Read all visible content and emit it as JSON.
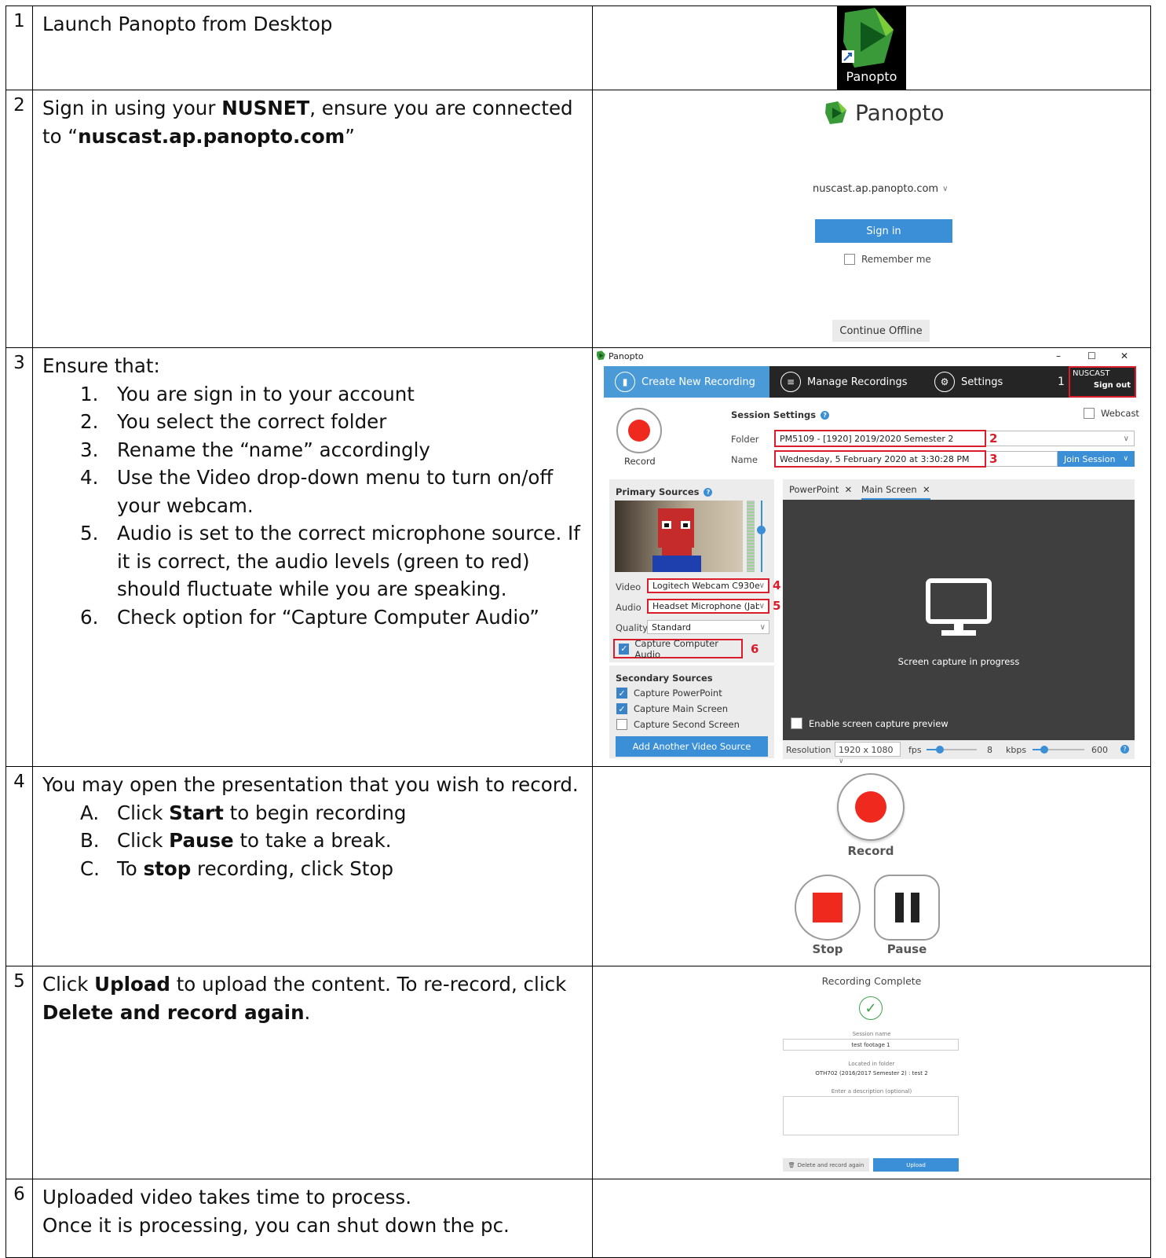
{
  "steps": [
    {
      "number": "1",
      "text": "Launch Panopto from Desktop",
      "image": {
        "icon_label": "Panopto"
      }
    },
    {
      "number": "2",
      "text_parts": [
        "Sign in using your ",
        "NUSNET",
        ", ensure you are connected to “",
        "nuscast.ap.panopto.com",
        "”"
      ],
      "image": {
        "logo_text": "Panopto",
        "server": "nuscast.ap.panopto.com",
        "sign_in": "Sign in",
        "remember_me": "Remember me",
        "continue_offline": "Continue Offline"
      }
    },
    {
      "number": "3",
      "intro": "Ensure that:",
      "items": [
        {
          "marker": "1.",
          "text": "You are sign in to your account"
        },
        {
          "marker": "2.",
          "text": "You select the correct folder"
        },
        {
          "marker": "3.",
          "text": "Rename the “name” accordingly"
        },
        {
          "marker": "4.",
          "text": "Use the Video drop-down menu to turn on/off your webcam."
        },
        {
          "marker": "5.",
          "text": "Audio is set to the correct microphone source. If it is correct, the audio levels (green to red) should fluctuate while you are speaking."
        },
        {
          "marker": "6.",
          "text": "Check option for “Capture Computer Audio”"
        }
      ],
      "app": {
        "window_title": "Panopto",
        "window_controls": [
          "–",
          "☐",
          "✕"
        ],
        "tabs": [
          "Create New Recording",
          "Manage Recordings",
          "Settings"
        ],
        "badge": "1",
        "account": "NUSCAST",
        "sign_out": "Sign out",
        "record_label": "Record",
        "session_settings": "Session Settings",
        "webcast": "Webcast",
        "folder_label": "Folder",
        "folder_value": "PM5109 - [1920] 2019/2020 Semester 2",
        "name_label": "Name",
        "name_value": "Wednesday, 5 February 2020 at 3:30:28 PM",
        "join_session": "Join Session",
        "primary_sources": "Primary Sources",
        "video_label": "Video",
        "video_value": "Logitech Webcam C930e",
        "audio_label": "Audio",
        "audio_value": "Headset Microphone (Jabr",
        "quality_label": "Quality",
        "quality_value": "Standard",
        "capture_audio": "Capture Computer Audio",
        "secondary_sources": "Secondary Sources",
        "capture_ppt": "Capture PowerPoint",
        "capture_main": "Capture Main Screen",
        "capture_second": "Capture Second Screen",
        "add_source": "Add Another Video Source",
        "preview_tabs": [
          "PowerPoint",
          "Main Screen"
        ],
        "screen_capture": "Screen capture in progress",
        "enable_preview": "Enable screen capture preview",
        "resolution_label": "Resolution",
        "resolution_value": "1920 x 1080",
        "fps_label": "fps",
        "fps_value": "8",
        "kbps_label": "kbps",
        "kbps_value": "600",
        "callouts": [
          "2",
          "3",
          "4",
          "5",
          "6"
        ]
      }
    },
    {
      "number": "4",
      "intro": "You may open the presentation that you wish to record.",
      "items": [
        {
          "marker": "A.",
          "parts": [
            "Click ",
            "Start",
            " to begin recording"
          ]
        },
        {
          "marker": "B.",
          "parts": [
            "Click ",
            "Pause",
            " to take a break."
          ]
        },
        {
          "marker": "C.",
          "parts": [
            "To ",
            "stop",
            " recording, click Stop"
          ]
        }
      ],
      "image": {
        "record": "Record",
        "stop": "Stop",
        "pause": "Pause"
      }
    },
    {
      "number": "5",
      "parts": [
        "Click ",
        "Upload",
        " to upload the content. To re-record, click ",
        "Delete and record again",
        "."
      ],
      "image": {
        "title": "Recording Complete",
        "session_name_label": "Session name",
        "session_name": "test footage 1",
        "folder_label": "Located in folder",
        "folder": "OTH702 (2016/2017 Semester 2) : test 2",
        "description_label": "Enter a description (optional)",
        "delete_button": "Delete and record again",
        "upload_button": "Upload"
      }
    },
    {
      "number": "6",
      "lines": [
        "Uploaded video takes time to process.",
        "Once it is processing, you can shut down the pc."
      ]
    }
  ],
  "colors": {
    "accent": "#4a9ad8",
    "callout_red": "#d91d2a",
    "record_red": "#f0291f"
  }
}
